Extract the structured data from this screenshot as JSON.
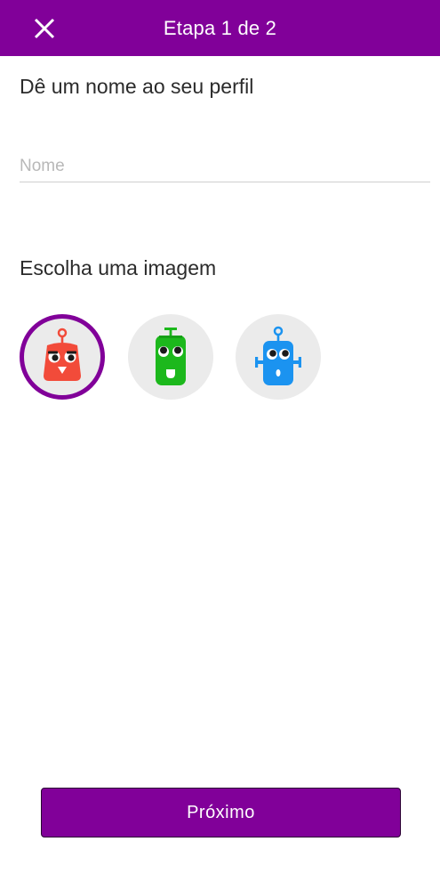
{
  "header": {
    "title": "Etapa 1 de 2",
    "close_icon": "close-icon",
    "background_color": "#810099"
  },
  "profile": {
    "name_heading": "Dê um nome ao seu perfil",
    "name_placeholder": "Nome",
    "name_value": "",
    "image_heading": "Escolha uma imagem"
  },
  "avatars": [
    {
      "icon": "red-robot-icon",
      "color": "#f24b3a",
      "selected": true
    },
    {
      "icon": "green-robot-icon",
      "color": "#1cb81c",
      "selected": false
    },
    {
      "icon": "blue-robot-icon",
      "color": "#1b93f0",
      "selected": false
    }
  ],
  "footer": {
    "next_label": "Próximo"
  },
  "colors": {
    "accent": "#810099",
    "avatar_background": "#ebebeb"
  }
}
